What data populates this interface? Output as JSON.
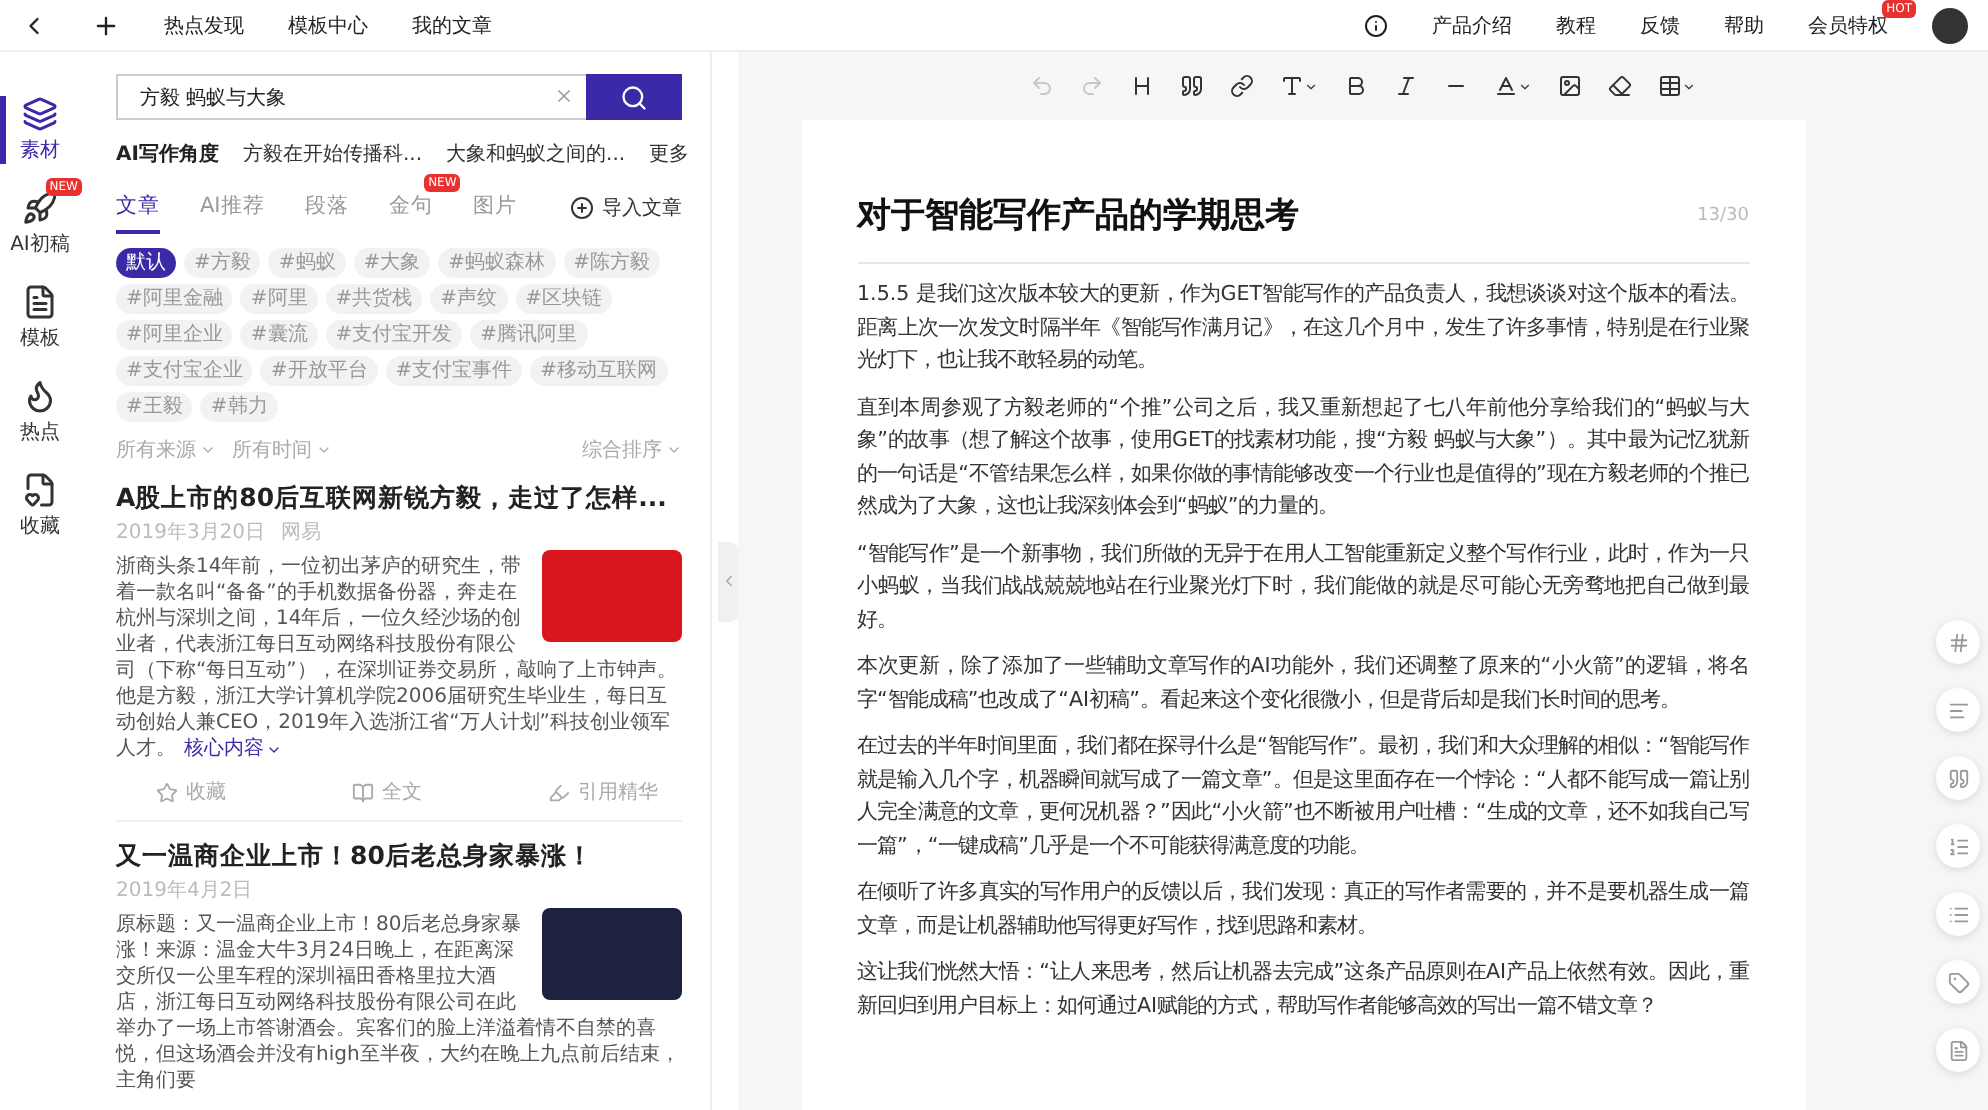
{
  "top_bar": {
    "nav": [
      "热点发现",
      "模板中心",
      "我的文章"
    ],
    "links": [
      "产品介绍",
      "教程",
      "反馈",
      "帮助"
    ],
    "vip": {
      "label": "会员特权",
      "badge": "HOT"
    }
  },
  "rail": [
    {
      "kind": "layers",
      "label": "素材",
      "selected": true
    },
    {
      "kind": "rocket",
      "label": "AI初稿",
      "selected": false,
      "badge": "NEW"
    },
    {
      "kind": "template",
      "label": "模板",
      "selected": false
    },
    {
      "kind": "flame",
      "label": "热点",
      "selected": false
    },
    {
      "kind": "star",
      "label": "收藏",
      "selected": false
    }
  ],
  "search": {
    "value": "方毅 蚂蚁与大象"
  },
  "ai_angles": {
    "label": "AI写作角度",
    "items": [
      "方毅在开始传播科...",
      "大象和蚂蚁之间的..."
    ],
    "more": "更多"
  },
  "tabs": [
    {
      "label": "文章",
      "selected": true
    },
    {
      "label": "AI推荐",
      "selected": false
    },
    {
      "label": "段落",
      "selected": false
    },
    {
      "label": "金句",
      "selected": false,
      "badge": "NEW"
    },
    {
      "label": "图片",
      "selected": false
    }
  ],
  "import_label": "导入文章",
  "tags": [
    {
      "label": "默认",
      "selected": true
    },
    {
      "label": "#方毅",
      "selected": false
    },
    {
      "label": "#蚂蚁",
      "selected": false
    },
    {
      "label": "#大象",
      "selected": false
    },
    {
      "label": "#蚂蚁森林",
      "selected": false
    },
    {
      "label": "#陈方毅",
      "selected": false
    },
    {
      "label": "#阿里金融",
      "selected": false
    },
    {
      "label": "#阿里",
      "selected": false
    },
    {
      "label": "#共货栈",
      "selected": false
    },
    {
      "label": "#声纹",
      "selected": false
    },
    {
      "label": "#区块链",
      "selected": false
    },
    {
      "label": "#阿里企业",
      "selected": false
    },
    {
      "label": "#囊流",
      "selected": false
    },
    {
      "label": "#支付宝开发",
      "selected": false
    },
    {
      "label": "#腾讯阿里",
      "selected": false
    },
    {
      "label": "#支付宝企业",
      "selected": false
    },
    {
      "label": "#开放平台",
      "selected": false
    },
    {
      "label": "#支付宝事件",
      "selected": false
    },
    {
      "label": "#移动互联网",
      "selected": false
    },
    {
      "label": "#王毅",
      "selected": false
    },
    {
      "label": "#韩力",
      "selected": false
    }
  ],
  "filters": {
    "left": [
      "所有来源",
      "所有时间"
    ],
    "sort": "综合排序"
  },
  "articles": [
    {
      "title": "A股上市的80后互联网新锐方毅，走过了怎样...",
      "date": "2019年3月20日",
      "source": "网易",
      "color": "#d8161c",
      "body": "浙商头条14年前，一位初出茅庐的研究生，带着一款名叫“备备”的手机数据备份器，奔走在杭州与深圳之间，14年后，一位久经沙场的创业者，代表浙江每日互动网络科技股份有限公司（下称“每日互动”），在深圳证券交易所，敲响了上市钟声。他是方毅，浙江大学计算机学院2006届研究生毕业生，每日互动创始人兼CEO，2019年入选浙江省“万人计划”科技创业领军人才。",
      "more": "核心内容",
      "actions": [
        "收藏",
        "全文",
        "引用精华"
      ]
    },
    {
      "title": "又一温商企业上市！80后老总身家暴涨！",
      "date": "2019年4月2日",
      "color": "#1c2240",
      "body": "原标题：又一温商企业上市！80后老总身家暴涨！来源：温金大牛3月24日晚上，在距离深交所仅一公里车程的深圳福田香格里拉大酒店，浙江每日互动网络科技股份有限公司在此举办了一场上市答谢酒会。宾客们的脸上洋溢着情不自禁的喜悦，但这场酒会并没有high至半夜，大约在晚上九点前后结束，主角们要"
    }
  ],
  "toolbar": [
    {
      "kind": "undo",
      "disabled": true
    },
    {
      "kind": "redo",
      "disabled": true
    },
    {
      "kind": "heading",
      "disabled": false
    },
    {
      "kind": "quote",
      "disabled": false
    },
    {
      "kind": "link",
      "disabled": false
    },
    {
      "kind": "text-size",
      "disabled": false
    },
    {
      "kind": "bold",
      "disabled": false
    },
    {
      "kind": "italic",
      "disabled": false
    },
    {
      "kind": "rule",
      "disabled": false
    },
    {
      "kind": "font-color",
      "disabled": false
    },
    {
      "kind": "image",
      "disabled": false
    },
    {
      "kind": "eraser",
      "disabled": false
    },
    {
      "kind": "table",
      "disabled": false
    }
  ],
  "document": {
    "title": "对于智能写作产品的学期思考",
    "counter": "13/30",
    "paragraphs": [
      "1.5.5 是我们这次版本较大的更新，作为GET智能写作的产品负责人，我想谈谈对这个版本的看法。距离上次一次发文时隔半年《智能写作满月记》，在这几个月中，发生了许多事情，特别是在行业聚光灯下，也让我不敢轻易的动笔。",
      "直到本周参观了方毅老师的“个推”公司之后，我又重新想起了七八年前他分享给我们的“蚂蚁与大象”的故事（想了解这个故事，使用GET的找素材功能，搜“方毅 蚂蚁与大象”）。其中最为记忆犹新的一句话是“不管结果怎么样，如果你做的事情能够改变一个行业也是值得的”现在方毅老师的个推已然成为了大象，这也让我深刻体会到“蚂蚁”的力量的。",
      "“智能写作”是一个新事物，我们所做的无异于在用人工智能重新定义整个写作行业，此时，作为一只小蚂蚁，当我们战战兢兢地站在行业聚光灯下时，我们能做的就是尽可能心无旁骛地把自己做到最好。",
      "本次更新，除了添加了一些辅助文章写作的AI功能外，我们还调整了原来的“小火箭”的逻辑，将名字“智能成稿”也改成了“AI初稿”。看起来这个变化很微小，但是背后却是我们长时间的思考。",
      "在过去的半年时间里面，我们都在探寻什么是“智能写作”。最初，我们和大众理解的相似：“智能写作就是输入几个字，机器瞬间就写成了一篇文章”。但是这里面存在一个悖论：“人都不能写成一篇让别人完全满意的文章，更何况机器？”因此“小火箭”也不断被用户吐槽：“生成的文章，还不如我自己写一篇”，“一键成稿”几乎是一个不可能获得满意度的功能。",
      "在倾听了许多真实的写作用户的反馈以后，我们发现：真正的写作者需要的，并不是要机器生成一篇文章，而是让机器辅助他写得更好写作，找到思路和素材。",
      "这让我们恍然大悟：“让人来思考，然后让机器去完成”这条产品原则在AI产品上依然有效。因此，重新回归到用户目标上：如何通过AI赋能的方式，帮助写作者能够高效的写出一篇不错文章？"
    ]
  }
}
